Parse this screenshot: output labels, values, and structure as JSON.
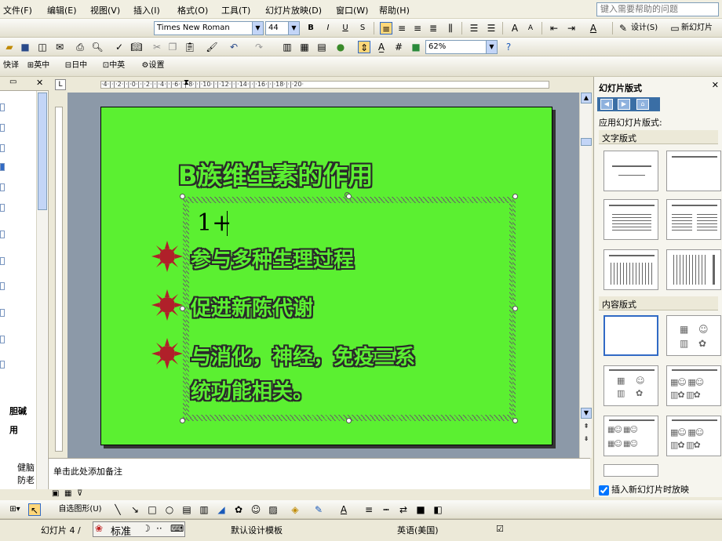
{
  "menubar": {
    "items": [
      "文件(F)",
      "编辑(E)",
      "视图(V)",
      "插入(I)",
      "格式(O)",
      "工具(T)",
      "幻灯片放映(D)",
      "窗口(W)",
      "帮助(H)"
    ],
    "help_placeholder": "键入需要帮助的问题"
  },
  "format_toolbar": {
    "font_name": "Times New Roman",
    "font_size": "44",
    "bold": "B",
    "italic": "I",
    "underline": "U",
    "shadow": "S",
    "design_label": "设计(S)",
    "new_slide_label": "新幻灯片(N)"
  },
  "standard_toolbar": {
    "zoom": "62%"
  },
  "ime_toolbar": {
    "items": [
      "快译",
      "英中",
      "日中",
      "中英",
      "设置"
    ]
  },
  "ruler": {
    "h_marks": "·4·|·|·2·|·|·0·|·|·2·|·|·4·|·|·6·|·|·8·|·|·10·|·|·12·|·|·14·|·|·16·|·|·18·|·|·20·"
  },
  "left_pane": {
    "partial_text_1": "胆碱",
    "partial_text_2": "用",
    "partial_text_3": "健脑",
    "partial_text_4": "防老"
  },
  "slide": {
    "title": "B族维生素的作用",
    "typed_text": "1+",
    "bullets": [
      "参与多种生理过程",
      "促进新陈代谢",
      "与消化，神经，免疫三系",
      "统功能相关。"
    ],
    "colors": {
      "background": "#5bf031",
      "bullet": "#b0202a"
    }
  },
  "notes": {
    "placeholder": "单击此处添加备注"
  },
  "task_pane": {
    "title": "幻灯片版式",
    "apply_label": "应用幻灯片版式:",
    "section_text": "文字版式",
    "section_content": "内容版式",
    "checkbox_label": "插入新幻灯片时放映"
  },
  "drawing_toolbar": {
    "autoshapes": "自选图形(U)"
  },
  "statusbar": {
    "slide_info": "幻灯片 4 /",
    "ime_mode": "标准",
    "template": "默认设计模板",
    "language": "英语(美国)"
  }
}
